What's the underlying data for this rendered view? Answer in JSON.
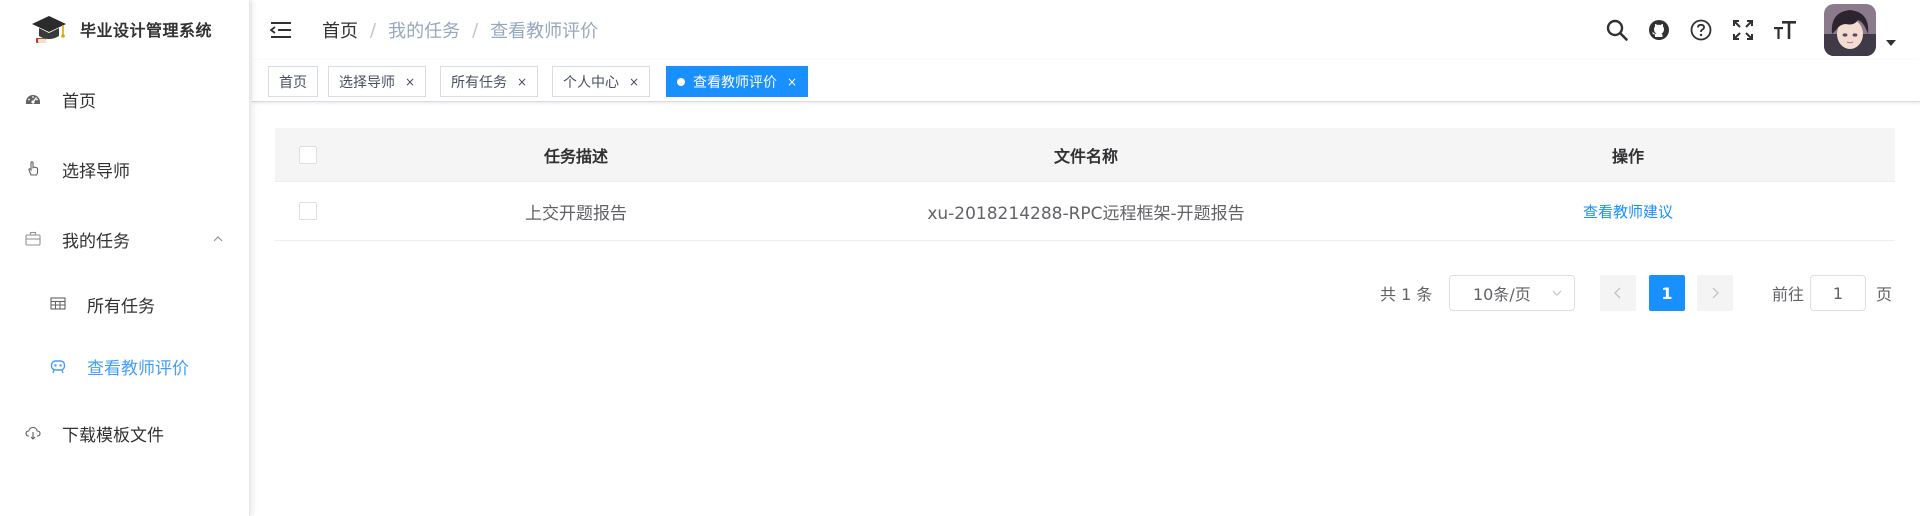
{
  "app": {
    "title": "毕业设计管理系统"
  },
  "sidebar": {
    "items": [
      {
        "label": "首页",
        "icon": "dashboard-icon"
      },
      {
        "label": "选择导师",
        "icon": "hand-pointer-icon"
      },
      {
        "label": "我的任务",
        "icon": "briefcase-icon",
        "expanded": true,
        "children": [
          {
            "label": "所有任务",
            "icon": "table-icon"
          },
          {
            "label": "查看教师评价",
            "icon": "robot-icon",
            "active": true
          }
        ]
      },
      {
        "label": "下载模板文件",
        "icon": "cloud-download-icon"
      }
    ]
  },
  "header": {
    "breadcrumb": [
      "首页",
      "我的任务",
      "查看教师评价"
    ],
    "icons": [
      "search-icon",
      "github-icon",
      "help-icon",
      "fullscreen-icon",
      "font-size-icon"
    ]
  },
  "tags": [
    {
      "label": "首页",
      "closable": false
    },
    {
      "label": "选择导师",
      "closable": true
    },
    {
      "label": "所有任务",
      "closable": true
    },
    {
      "label": "个人中心",
      "closable": true
    },
    {
      "label": "查看教师评价",
      "closable": true,
      "active": true
    }
  ],
  "tag_close_glyph": "×",
  "table": {
    "columns": [
      "任务描述",
      "文件名称",
      "操作"
    ],
    "rows": [
      {
        "desc": "上交开题报告",
        "file": "xu-2018214288-RPC远程框架-开题报告",
        "action": "查看教师建议"
      }
    ]
  },
  "pagination": {
    "total_text": "共 1 条",
    "page_size": "10条/页",
    "current_page": "1",
    "goto_label": "前往",
    "goto_value": "1",
    "goto_suffix": "页"
  },
  "colors": {
    "primary": "#1890ff",
    "active_menu": "#409eff",
    "breadcrumb_muted": "#97a8be"
  }
}
